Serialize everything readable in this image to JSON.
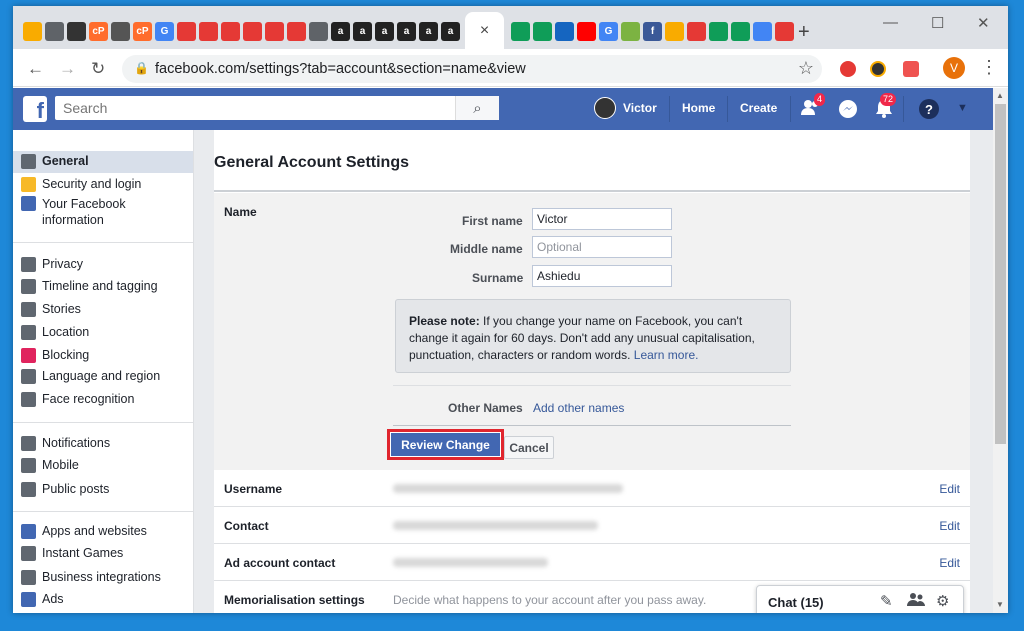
{
  "browser": {
    "tabs": [
      {
        "label": "",
        "color": "#f9ab00"
      },
      {
        "label": "",
        "color": "#5f6368"
      },
      {
        "label": "",
        "color": "#333333"
      },
      {
        "label": "cP",
        "color": "#ff6c2c"
      },
      {
        "label": "",
        "color": "#555555"
      },
      {
        "label": "cP",
        "color": "#ff6c2c"
      },
      {
        "label": "G",
        "color": "#4285f4"
      },
      {
        "label": "",
        "color": "#e53935"
      },
      {
        "label": "",
        "color": "#e53935"
      },
      {
        "label": "",
        "color": "#e53935"
      },
      {
        "label": "",
        "color": "#e53935"
      },
      {
        "label": "",
        "color": "#e53935"
      },
      {
        "label": "",
        "color": "#e53935"
      },
      {
        "label": "",
        "color": "#5f6368"
      },
      {
        "label": "a",
        "color": "#222222"
      },
      {
        "label": "a",
        "color": "#222222"
      },
      {
        "label": "a",
        "color": "#222222"
      },
      {
        "label": "a",
        "color": "#222222"
      },
      {
        "label": "a",
        "color": "#222222"
      },
      {
        "label": "a",
        "color": "#222222"
      }
    ],
    "tabs_right": [
      {
        "label": "",
        "color": "#0f9d58"
      },
      {
        "label": "",
        "color": "#0f9d58"
      },
      {
        "label": "",
        "color": "#1565c0"
      },
      {
        "label": "",
        "color": "#ff0000"
      },
      {
        "label": "G",
        "color": "#4285f4"
      },
      {
        "label": "",
        "color": "#7cb342"
      },
      {
        "label": "f",
        "color": "#3b5998"
      },
      {
        "label": "",
        "color": "#f9ab00"
      },
      {
        "label": "",
        "color": "#e53935"
      },
      {
        "label": "",
        "color": "#0f9d58"
      },
      {
        "label": "",
        "color": "#0f9d58"
      },
      {
        "label": "",
        "color": "#4285f4"
      },
      {
        "label": "",
        "color": "#e53935"
      }
    ],
    "active_tab_close": "×",
    "new_tab": "+",
    "minimize": "—",
    "maximize": "☐",
    "close": "✕",
    "back": "←",
    "forward": "→",
    "reload": "↻",
    "lock": "🔒",
    "url": "facebook.com/settings?tab=account&section=name&view",
    "bookmark_star": "☆",
    "profile_initial": "V",
    "menu": "⋮"
  },
  "facebook": {
    "logo": "f",
    "search_placeholder": "Search",
    "search_icon": "⌕",
    "profile_name": "Victor",
    "home": "Home",
    "create": "Create",
    "friend_requests_count": "4",
    "notifications_count": "72",
    "help": "?",
    "dropdown": "▼"
  },
  "sidebar": {
    "items": [
      {
        "label": "General",
        "icon": "gears-icon",
        "color": "#606770"
      },
      {
        "label": "Security and login",
        "icon": "badge-icon",
        "color": "#f7b928"
      },
      {
        "label": "Your Facebook information",
        "icon": "facebook-icon",
        "color": "#4267b2"
      },
      {
        "label": "Privacy",
        "icon": "lock-icon",
        "color": "#606770"
      },
      {
        "label": "Timeline and tagging",
        "icon": "timeline-icon",
        "color": "#606770"
      },
      {
        "label": "Stories",
        "icon": "book-icon",
        "color": "#606770"
      },
      {
        "label": "Location",
        "icon": "location-icon",
        "color": "#606770"
      },
      {
        "label": "Blocking",
        "icon": "block-icon",
        "color": "#e0245e"
      },
      {
        "label": "Language and region",
        "icon": "language-icon",
        "color": "#606770"
      },
      {
        "label": "Face recognition",
        "icon": "face-icon",
        "color": "#606770"
      },
      {
        "label": "Notifications",
        "icon": "globe-icon",
        "color": "#606770"
      },
      {
        "label": "Mobile",
        "icon": "mobile-icon",
        "color": "#606770"
      },
      {
        "label": "Public posts",
        "icon": "rss-icon",
        "color": "#606770"
      },
      {
        "label": "Apps and websites",
        "icon": "apps-icon",
        "color": "#4267b2"
      },
      {
        "label": "Instant Games",
        "icon": "gamepad-icon",
        "color": "#606770"
      },
      {
        "label": "Business integrations",
        "icon": "business-icon",
        "color": "#606770"
      },
      {
        "label": "Ads",
        "icon": "ads-icon",
        "color": "#4267b2"
      }
    ]
  },
  "main": {
    "title": "General Account Settings",
    "name_section": {
      "label": "Name",
      "first_name_label": "First name",
      "first_name_value": "Victor",
      "middle_name_label": "Middle name",
      "middle_name_placeholder": "Optional",
      "surname_label": "Surname",
      "surname_value": "Ashiedu",
      "note_bold": "Please note:",
      "note_text": " If you change your name on Facebook, you can't change it again for 60 days. Don't add any unusual capitalisation, punctuation, characters or random words. ",
      "note_link": "Learn more.",
      "other_names_label": "Other Names",
      "other_names_link": "Add other names",
      "review_button": "Review Change",
      "cancel_button": "Cancel"
    },
    "rows": [
      {
        "label": "Username",
        "value": "",
        "edit": "Edit"
      },
      {
        "label": "Contact",
        "value": "",
        "edit": "Edit"
      },
      {
        "label": "Ad account contact",
        "value": "",
        "edit": "Edit"
      },
      {
        "label": "Memorialisation settings",
        "value": "Decide what happens to your account after you pass away.",
        "edit": ""
      }
    ]
  },
  "chat": {
    "label": "Chat (15)",
    "compose_icon": "✎",
    "people_icon": "👥",
    "settings_icon": "⚙"
  }
}
